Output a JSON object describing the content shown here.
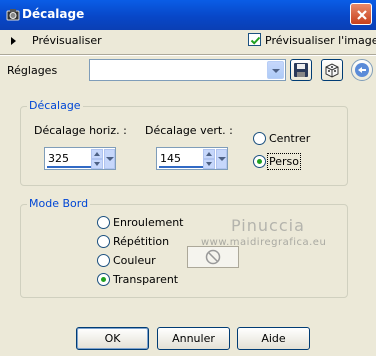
{
  "window": {
    "title": "Décalage"
  },
  "preview": {
    "toggle_label": "Prévisualiser",
    "checkbox_label": "Prévisualiser l'image",
    "checked": true
  },
  "presets": {
    "label": "Réglages",
    "value": ""
  },
  "offset_group": {
    "title": "Décalage",
    "horiz_label": "Décalage horiz. :",
    "horiz_value": "325",
    "vert_label": "Décalage vert. :",
    "vert_value": "145",
    "options": [
      {
        "label": "Centrer",
        "selected": false
      },
      {
        "label": "Perso",
        "selected": true
      }
    ]
  },
  "edge_group": {
    "title": "Mode Bord",
    "options": [
      {
        "label": "Enroulement",
        "selected": false
      },
      {
        "label": "Répétition",
        "selected": false
      },
      {
        "label": "Couleur",
        "selected": false
      },
      {
        "label": "Transparent",
        "selected": true
      }
    ]
  },
  "watermark": {
    "name": "Pinuccia",
    "site": "www.maidiregrafica.eu"
  },
  "buttons": {
    "ok": "OK",
    "cancel": "Annuler",
    "help": "Aide"
  },
  "colors": {
    "titlebar": "#0a5de6",
    "group_title": "#0046d5",
    "radio_selected": "#21a121"
  }
}
